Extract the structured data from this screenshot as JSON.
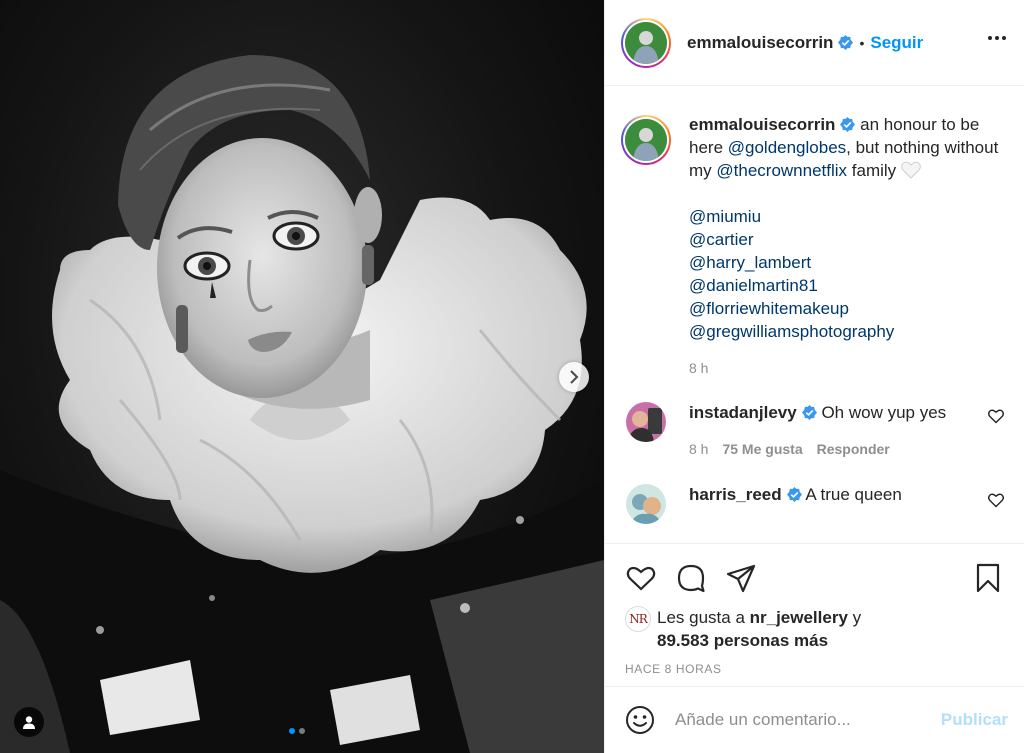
{
  "post": {
    "username": "emmalouisecorrin",
    "separator": "•",
    "follow_label": "Seguir",
    "more_icon": "more-options-icon"
  },
  "caption": {
    "username": "emmalouisecorrin",
    "text_1": " an honour to be here ",
    "mention_1": "@goldenglobes",
    "text_2": ", but nothing without my ",
    "mention_2": "@thecrownnetflix",
    "text_3": " family ",
    "credits": [
      "@miumiu",
      "@cartier",
      "@harry_lambert",
      "@danielmartin81",
      "@florriewhitemakeup",
      "@gregwilliamsphotography"
    ],
    "time": "8 h"
  },
  "comments": [
    {
      "username": "instadanjlevy",
      "text": " Oh wow yup yes",
      "time": "8 h",
      "likes": "75 Me gusta",
      "reply": "Responder"
    },
    {
      "username": "harris_reed",
      "text": " A true queen"
    }
  ],
  "likes": {
    "avatar_initials": "NR",
    "prefix": "Les gusta a ",
    "user": "nr_jewellery",
    "middle": " y",
    "count": "89.583 personas más"
  },
  "posted_ago": "HACE 8 HORAS",
  "add_comment": {
    "placeholder": "Añade un comentario...",
    "submit_label": "Publicar"
  },
  "carousel": {
    "current": 1,
    "total": 2
  },
  "colors": {
    "accent": "#0095f6",
    "mention": "#00376b",
    "muted": "#8e8e8e",
    "submit_disabled": "#b2dffc"
  }
}
